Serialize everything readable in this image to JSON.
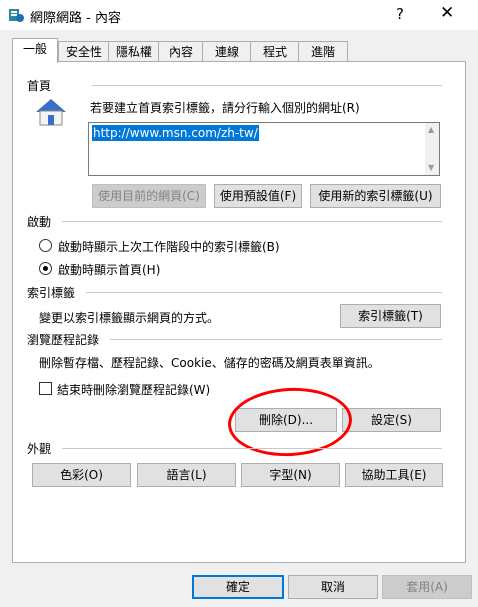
{
  "window": {
    "title": "網際網路 - 內容",
    "help_glyph": "?",
    "close_glyph": "✕"
  },
  "tabs": [
    "一般",
    "安全性",
    "隱私權",
    "內容",
    "連線",
    "程式",
    "進階"
  ],
  "home_page": {
    "header": "首頁",
    "instruction": "若要建立首頁索引標籤，請分行輸入個別的網址(R)",
    "url": "http://www.msn.com/zh-tw/",
    "buttons": [
      "使用目前的網頁(C)",
      "使用預設值(F)",
      "使用新的索引標籤(U)"
    ]
  },
  "startup": {
    "header": "啟動",
    "options": [
      "啟動時顯示上次工作階段中的索引標籤(B)",
      "啟動時顯示首頁(H)"
    ],
    "selected_index": 1
  },
  "tabs_section": {
    "header": "索引標籤",
    "description": "變更以索引標籤顯示網頁的方式。",
    "button": "索引標籤(T)"
  },
  "history": {
    "header": "瀏覽歷程記錄",
    "description": "刪除暫存檔、歷程記錄、Cookie、儲存的密碼及網頁表單資訊。",
    "checkbox_label": "結束時刪除瀏覽歷程記錄(W)",
    "checkbox_checked": false,
    "delete_button": "刪除(D)...",
    "settings_button": "設定(S)"
  },
  "appearance": {
    "header": "外觀",
    "buttons": [
      "色彩(O)",
      "語言(L)",
      "字型(N)",
      "協助工具(E)"
    ]
  },
  "footer": {
    "ok": "確定",
    "cancel": "取消",
    "apply": "套用(A)"
  },
  "annotation_color": "#ff0000",
  "accent_color": "#0078d7"
}
